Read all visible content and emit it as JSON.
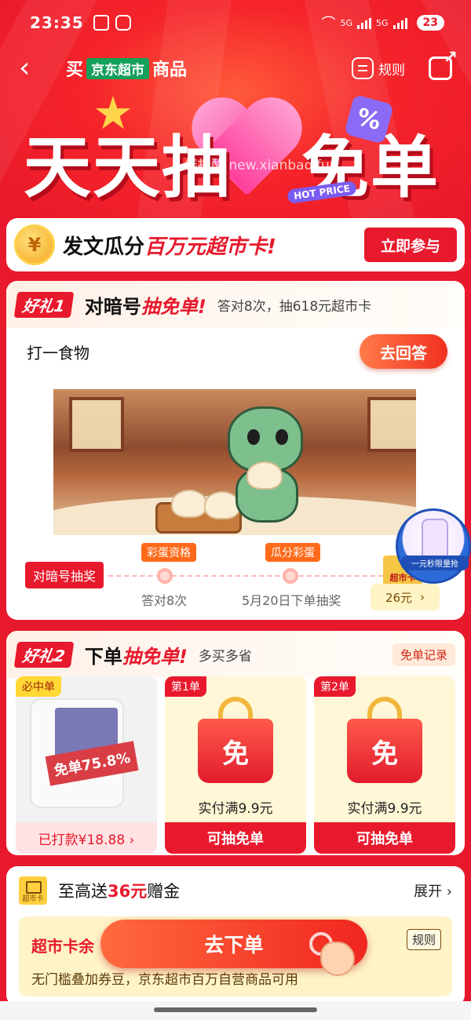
{
  "status_bar": {
    "time": "23:35",
    "signal_1": "5G",
    "signal_2": "5G",
    "battery": "23"
  },
  "nav": {
    "title_prefix": "买",
    "title_badge": "京东超市",
    "title_suffix": "商品",
    "rule_label": "规则"
  },
  "hero": {
    "title_left": "天天抽",
    "title_right": "免单",
    "hot_tag": "HOT PRICE",
    "percent_tag": "%",
    "watermark": "线报酷 new.xianbao.fun"
  },
  "promo": {
    "coin_symbol": "¥",
    "text_plain": "发文瓜分",
    "text_highlight": "百万元超市卡!",
    "button": "立即参与"
  },
  "gift1": {
    "tag": "好礼1",
    "title_plain": "对暗号",
    "title_highlight": "抽免单!",
    "subtitle": "答对8次，抽618元超市卡",
    "question": "打一食物",
    "answer_button": "去回答",
    "timeline": {
      "start": "对暗号抽奖",
      "step1_tag": "彩蛋资格",
      "step1_label": "答对8次",
      "step2_tag": "瓜分彩蛋",
      "step2_label": "5月20日下单抽奖",
      "card_top": "超市卡",
      "card_value": "26元",
      "card_arrow": "›"
    }
  },
  "float_ad": {
    "label": "一元秒限量抢"
  },
  "gift2": {
    "tag": "好礼2",
    "title_plain": "下单",
    "title_highlight": "抽免单!",
    "subtitle": "多买多省",
    "record_button": "免单记录",
    "products": [
      {
        "tag": "必中单",
        "ribbon": "免单75.8%",
        "bottom": "已打款¥18.88 ›"
      },
      {
        "tag": "第1单",
        "icon_text": "免",
        "condition": "实付满9.9元",
        "button": "可抽免单"
      },
      {
        "tag": "第2单",
        "icon_text": "免",
        "condition": "实付满9.9元",
        "button": "可抽免单"
      }
    ]
  },
  "card_bonus": {
    "icon_label": "超市卡",
    "title_plain": "至高送",
    "title_highlight": "36元",
    "title_suffix": "赠金",
    "expand": "展开 ›",
    "balance_label": "超市卡余",
    "rule_button": "规则",
    "description": "无门槛叠加券豆，京东超市百万自营商品可用",
    "order_button": "去下单"
  },
  "colors": {
    "brand_red": "#e8192c",
    "jd_green": "#14a05a",
    "gold": "#ffd54a"
  }
}
